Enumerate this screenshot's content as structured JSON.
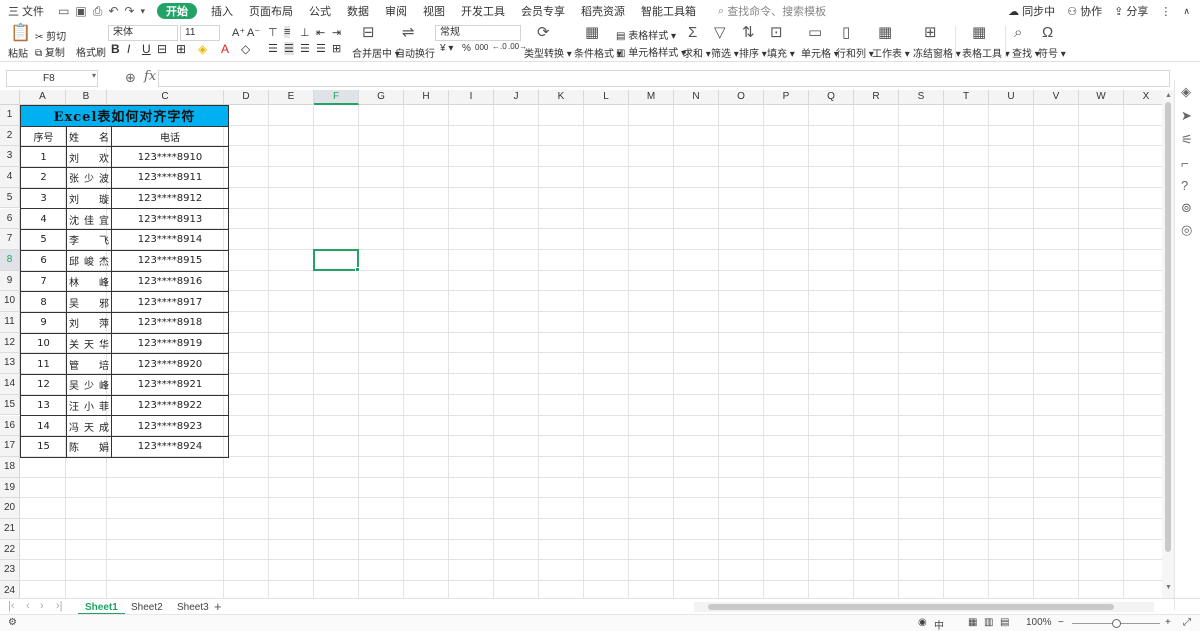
{
  "menubar": {
    "file_label": "三 文件",
    "quick_icons": [
      "save-icon",
      "print-preview-icon",
      "print-icon",
      "undo-icon",
      "redo-icon"
    ],
    "tabs": [
      "开始",
      "插入",
      "页面布局",
      "公式",
      "数据",
      "审阅",
      "视图",
      "开发工具",
      "会员专享",
      "稻壳资源",
      "智能工具箱"
    ],
    "active_tab": "开始",
    "search_placeholder": "查找命令、搜索模板",
    "sync_label": "同步中",
    "collab_label": "协作",
    "share_label": "分享"
  },
  "ribbon": {
    "paste": "粘贴",
    "cut": "剪切",
    "copy": "复制",
    "format_painter": "格式刷",
    "font_name": "宋体",
    "font_size": "11",
    "bold": "B",
    "italic": "I",
    "underline": "U",
    "merge_center": "合并居中",
    "wrap_text": "自动换行",
    "number_format": "常规",
    "currency": "¥",
    "percent": "%",
    "thousands": "000",
    "type_convert": "类型转换",
    "cond_format": "条件格式",
    "table_style": "表格样式",
    "cell_style": "单元格样式",
    "sum": "求和",
    "filter": "筛选",
    "sort": "排序",
    "fill": "填充",
    "cell": "单元格",
    "row_col": "行和列",
    "worksheet": "工作表",
    "freeze": "冻结窗格",
    "table_tools": "表格工具",
    "find": "查找",
    "symbol": "符号"
  },
  "formula_bar": {
    "name_box": "F8",
    "fx": "fx",
    "formula": ""
  },
  "grid": {
    "columns": [
      "A",
      "B",
      "C",
      "D",
      "E",
      "F",
      "G",
      "H",
      "I",
      "J",
      "K",
      "L",
      "M",
      "N",
      "O",
      "P",
      "Q",
      "R",
      "S",
      "T",
      "U",
      "V",
      "W",
      "X"
    ],
    "rows": [
      "1",
      "2",
      "3",
      "4",
      "5",
      "6",
      "7",
      "8",
      "9",
      "10",
      "11",
      "12",
      "13",
      "14",
      "15",
      "16",
      "17",
      "18",
      "19",
      "20",
      "21",
      "22",
      "23",
      "24"
    ],
    "selected_column": "F",
    "selected_row": "8",
    "selected_cell": "F8"
  },
  "table": {
    "title": "Excel表如何对齐字符",
    "headers": [
      "序号",
      "姓　　名",
      "电话"
    ],
    "rows": [
      [
        "1",
        "刘欢",
        "123****8910"
      ],
      [
        "2",
        "张少波",
        "123****8911"
      ],
      [
        "3",
        "刘璇",
        "123****8912"
      ],
      [
        "4",
        "沈佳宜",
        "123****8913"
      ],
      [
        "5",
        "李飞",
        "123****8914"
      ],
      [
        "6",
        "邱峻杰",
        "123****8915"
      ],
      [
        "7",
        "林峰",
        "123****8916"
      ],
      [
        "8",
        "吴邪",
        "123****8917"
      ],
      [
        "9",
        "刘萍",
        "123****8918"
      ],
      [
        "10",
        "关天华",
        "123****8919"
      ],
      [
        "11",
        "管培",
        "123****8920"
      ],
      [
        "12",
        "吴少峰",
        "123****8921"
      ],
      [
        "13",
        "汪小菲",
        "123****8922"
      ],
      [
        "14",
        "冯天成",
        "123****8923"
      ],
      [
        "15",
        "陈娟",
        "123****8924"
      ]
    ]
  },
  "sheets": {
    "tabs": [
      "Sheet1",
      "Sheet2",
      "Sheet3"
    ],
    "active": "Sheet1",
    "add": "+"
  },
  "status": {
    "zoom": "100%",
    "minus": "−",
    "plus": "+"
  },
  "colors": {
    "accent": "#21a366",
    "title_fill": "#00b0f0"
  }
}
